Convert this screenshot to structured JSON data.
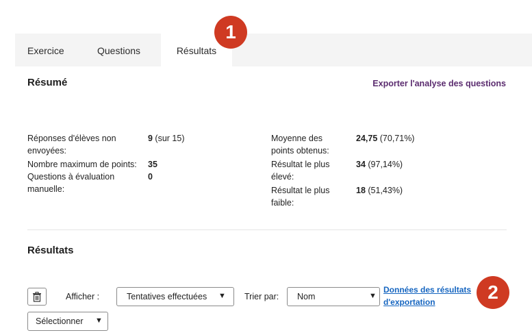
{
  "tabs": [
    {
      "label": "Exercice"
    },
    {
      "label": "Questions"
    },
    {
      "label": "Résultats"
    }
  ],
  "summary": {
    "title": "Résumé",
    "export_link": "Exporter l'analyse des questions",
    "left": [
      {
        "label1": "Réponses d'élèves non",
        "label2": "envoyées:",
        "value_bold": "9",
        "value_rest": " (sur 15)"
      },
      {
        "label1": "Nombre maximum de points:",
        "label2": "",
        "value_bold": "35",
        "value_rest": ""
      },
      {
        "label1": "Questions à évaluation",
        "label2": "manuelle:",
        "value_bold": "0",
        "value_rest": ""
      }
    ],
    "right": [
      {
        "label1": "Moyenne des",
        "label2": "points obtenus:",
        "value_bold": "24,75",
        "value_rest": " (70,71%)"
      },
      {
        "label1": "Résultat le plus",
        "label2": "élevé:",
        "value_bold": "34",
        "value_rest": " (97,14%)"
      },
      {
        "label1": "Résultat le plus",
        "label2": "faible:",
        "value_bold": "18",
        "value_rest": " (51,43%)"
      }
    ]
  },
  "results": {
    "title": "Résultats",
    "show_label": "Afficher :",
    "show_value": "Tentatives effectuées",
    "sort_label": "Trier par:",
    "sort_value": "Nom",
    "export_data_line1": "Données des résultats",
    "export_data_line2": "d'exportation",
    "select_label": "Sélectionner"
  },
  "badges": {
    "b1": "1",
    "b2": "2"
  },
  "colors": {
    "badge": "#cf3a22",
    "link_purple": "#5b2c6f",
    "link_blue": "#1565c0"
  }
}
